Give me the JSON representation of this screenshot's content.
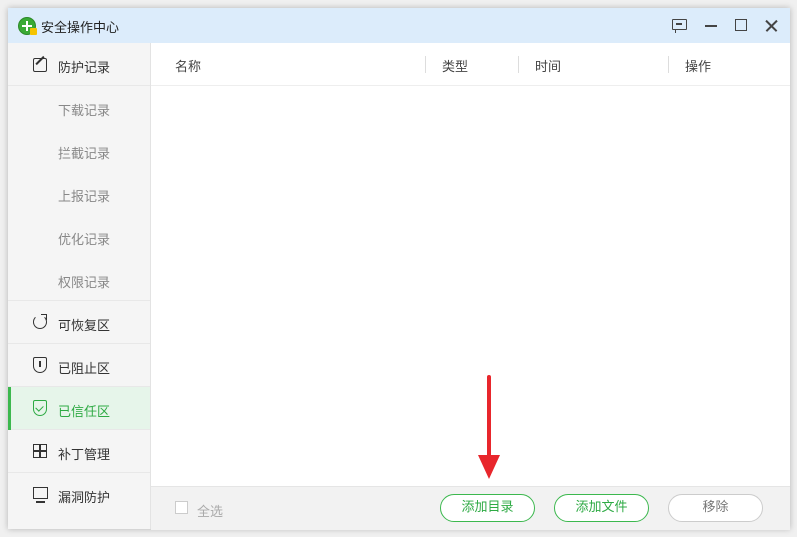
{
  "window": {
    "title": "安全操作中心"
  },
  "sidebar": {
    "items": [
      {
        "label": "防护记录",
        "icon": "edit-icon"
      },
      {
        "label": "下载记录"
      },
      {
        "label": "拦截记录"
      },
      {
        "label": "上报记录"
      },
      {
        "label": "优化记录"
      },
      {
        "label": "权限记录"
      },
      {
        "label": "可恢复区",
        "icon": "restore-icon"
      },
      {
        "label": "已阻止区",
        "icon": "shield-block-icon"
      },
      {
        "label": "已信任区",
        "icon": "shield-check-icon",
        "active": true
      },
      {
        "label": "补丁管理",
        "icon": "windows-icon"
      },
      {
        "label": "漏洞防护",
        "icon": "monitor-icon"
      }
    ]
  },
  "table": {
    "columns": [
      "名称",
      "类型",
      "时间",
      "操作"
    ],
    "rows": []
  },
  "footer": {
    "select_all_label": "全选",
    "add_dir_label": "添加目录",
    "add_file_label": "添加文件",
    "remove_label": "移除"
  },
  "colors": {
    "accent": "#2eaa44",
    "titlebar": "#dcecfb",
    "annotation_arrow": "#e8262c"
  }
}
